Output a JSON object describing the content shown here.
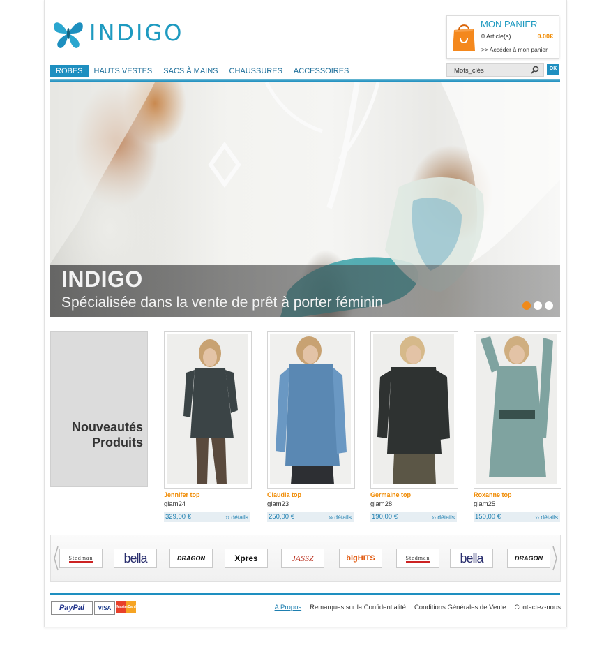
{
  "header": {
    "logo_text": "INDIGO"
  },
  "cart": {
    "title": "MON PANIER",
    "count": "0 Article(s)",
    "total": "0.00€",
    "link": ">> Accéder à mon panier"
  },
  "nav": {
    "items": [
      {
        "label": "ROBES",
        "active": true
      },
      {
        "label": "HAUTS VESTES"
      },
      {
        "label": "SACS À MAINS"
      },
      {
        "label": "CHAUSSURES"
      },
      {
        "label": "ACCESSOIRES"
      }
    ]
  },
  "search": {
    "value": "Mots_clés",
    "ok_label": "OK"
  },
  "hero": {
    "title": "INDIGO",
    "subtitle": "Spécialisée dans la vente de prêt à porter féminin",
    "active_slide": 1,
    "slide_count": 3
  },
  "new_products": {
    "line1": "Nouveautés",
    "line2": "Produits"
  },
  "products": [
    {
      "name": "Jennifer top",
      "ref": "glam24",
      "price": "329,00 €",
      "details": "›› détails",
      "color": "#3b4446"
    },
    {
      "name": "Claudia top",
      "ref": "glam23",
      "price": "250,00 €",
      "details": "›› détails",
      "color": "#5a88b3"
    },
    {
      "name": "Germaine top",
      "ref": "glam28",
      "price": "190,00 €",
      "details": "›› détails",
      "color": "#2e3231"
    },
    {
      "name": "Roxanne top",
      "ref": "glam25",
      "price": "150,00 €",
      "details": "›› détails",
      "color": "#7fa3a0"
    }
  ],
  "brands": [
    "Stedman",
    "bella",
    "DRAGON",
    "Xpres",
    "JASSZ",
    "bigHITS",
    "Stedman",
    "bella",
    "DRAGON"
  ],
  "footer": {
    "payments": [
      "PayPal",
      "VISA",
      "MasterCard"
    ],
    "links": [
      "A Propos",
      "Remarques sur la Confidentialité",
      "Conditions Générales de Vente",
      "Contactez-nous"
    ]
  },
  "colors": {
    "accent": "#1e8fc0",
    "orange": "#f08a00"
  }
}
